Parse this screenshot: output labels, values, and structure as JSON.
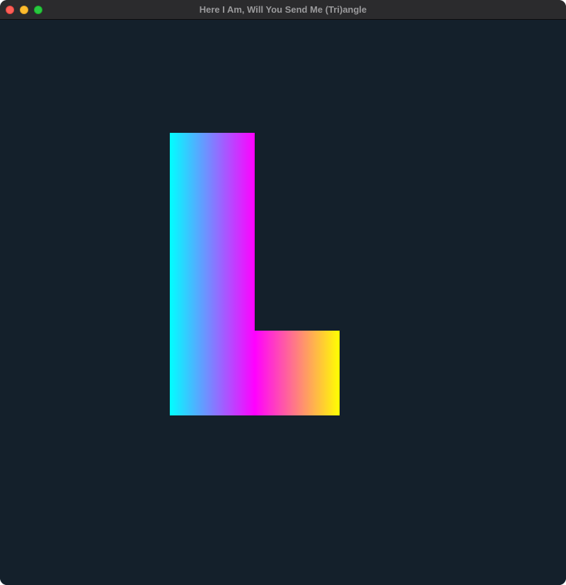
{
  "window": {
    "title": "Here I Am, Will You Send Me (Tri)angle"
  },
  "window_controls": {
    "close_color": "#fe5f57",
    "minimize_color": "#febc2e",
    "maximize_color": "#28c840"
  },
  "canvas": {
    "background_color": "#14202b",
    "shape": "L",
    "gradient_colors": [
      "#00ffff",
      "#ff00ff",
      "#ffff00"
    ]
  }
}
